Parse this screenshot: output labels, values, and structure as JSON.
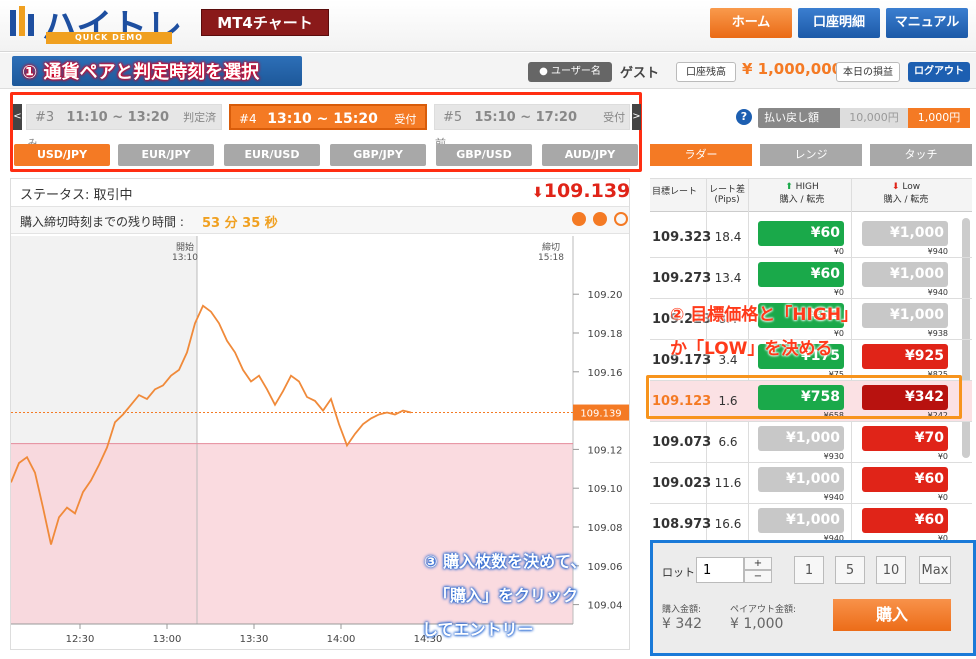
{
  "header": {
    "logo_text": "ハイトレ",
    "logo_sub": "QUICK DEMO",
    "mt4_button": "MT4チャート",
    "nav": [
      "ホーム",
      "口座明細",
      "マニュアル"
    ]
  },
  "account": {
    "user_badge": "ユーザー名",
    "user_name": "ゲスト",
    "balance_label": "口座残高",
    "balance_value": "¥ 1,000,000",
    "today_pl": "本日の損益",
    "logout": "ログアウト"
  },
  "annotations": {
    "step1": "① 通貨ペアと判定時刻を選択",
    "step2_line1": "② 目標価格と「HIGH」",
    "step2_line2": "か「LOW」を決める",
    "step3_line1": "③ 購入枚数を決めて、",
    "step3_line2": "「購入」をクリック",
    "step3_line3": "してエントリー"
  },
  "slots": [
    {
      "id": "#3",
      "time": "11:10 ~ 13:20",
      "status": "判定済み"
    },
    {
      "id": "#4",
      "time": "13:10 ~ 15:20",
      "status": "受付中"
    },
    {
      "id": "#5",
      "time": "15:10 ~ 17:20",
      "status": "受付前"
    }
  ],
  "slot_prev": "<",
  "slot_next": ">",
  "pairs": [
    "USD/JPY",
    "EUR/JPY",
    "EUR/USD",
    "GBP/JPY",
    "GBP/USD",
    "AUD/JPY"
  ],
  "payback": {
    "label": "払い戻し額",
    "opt1": "10,000円",
    "opt2": "1,000円"
  },
  "view_tabs": [
    "ラダー",
    "レンジ",
    "タッチ"
  ],
  "status": {
    "label": "ステータス: 取引中",
    "price": "109.139",
    "remaining_label": "購入締切時刻までの残り時間 :",
    "remaining_value": "53 分 35 秒"
  },
  "chart_labels": {
    "start": "開始",
    "start_time": "13:10",
    "close": "締切",
    "close_time": "15:18",
    "current": "109.139"
  },
  "chart_data": {
    "type": "line",
    "y_ticks": [
      "109.20",
      "109.18",
      "109.16",
      "109.14",
      "109.12",
      "109.10",
      "109.08",
      "109.06",
      "109.04"
    ],
    "x_ticks": [
      "12:30",
      "13:00",
      "13:30",
      "14:00",
      "14:30"
    ],
    "ylim": [
      109.03,
      109.23
    ],
    "target": 109.123,
    "current": 109.139,
    "series": [
      {
        "x": [
          0,
          8,
          16,
          24,
          32,
          40,
          48,
          56,
          64,
          72,
          80,
          88,
          96,
          104,
          112,
          120,
          128,
          136,
          144,
          152,
          160,
          168,
          176,
          184,
          192,
          200,
          208,
          216,
          224,
          232,
          240,
          248,
          256,
          264,
          272,
          280,
          288,
          296,
          304,
          312,
          320,
          328,
          336,
          344,
          352,
          360,
          368,
          376,
          384,
          392,
          400
        ],
        "y": [
          109.103,
          109.113,
          109.116,
          109.108,
          109.09,
          109.071,
          109.085,
          109.09,
          109.087,
          109.098,
          109.104,
          109.112,
          109.121,
          109.134,
          109.138,
          109.143,
          109.148,
          109.146,
          109.151,
          109.153,
          109.158,
          109.161,
          109.17,
          109.185,
          109.194,
          109.191,
          109.185,
          109.176,
          109.17,
          109.161,
          109.155,
          109.158,
          109.151,
          109.143,
          109.15,
          109.158,
          109.155,
          109.147,
          109.145,
          109.14,
          109.146,
          109.133,
          109.122,
          109.128,
          109.133,
          109.136,
          109.138,
          109.139,
          109.138,
          109.14,
          109.139
        ]
      }
    ]
  },
  "ladder": {
    "headers": {
      "rate": "目標レート",
      "diff": "レート差",
      "pips": "(Pips)",
      "high": "HIGH",
      "low": "Low",
      "buy": "購入 / 転売"
    },
    "rows": [
      {
        "rate": "109.323",
        "diff": "18.4",
        "high": "¥60",
        "high_sub": "¥0",
        "low": "¥1,000",
        "low_sub": "¥940"
      },
      {
        "rate": "109.273",
        "diff": "13.4",
        "high": "¥60",
        "high_sub": "¥0",
        "low": "¥1,000",
        "low_sub": "¥940"
      },
      {
        "rate": "109.223",
        "diff": "8.4",
        "high": "¥62",
        "high_sub": "¥0",
        "low": "¥1,000",
        "low_sub": "¥938"
      },
      {
        "rate": "109.173",
        "diff": "3.4",
        "high": "¥175",
        "high_sub": "¥75",
        "low": "¥925",
        "low_sub": "¥825"
      },
      {
        "rate": "109.123",
        "diff": "1.6",
        "high": "¥758",
        "high_sub": "¥658",
        "low": "¥342",
        "low_sub": "¥242"
      },
      {
        "rate": "109.073",
        "diff": "6.6",
        "high": "¥1,000",
        "high_sub": "¥930",
        "low": "¥70",
        "low_sub": "¥0"
      },
      {
        "rate": "109.023",
        "diff": "11.6",
        "high": "¥1,000",
        "high_sub": "¥940",
        "low": "¥60",
        "low_sub": "¥0"
      },
      {
        "rate": "108.973",
        "diff": "16.6",
        "high": "¥1,000",
        "high_sub": "¥940",
        "low": "¥60",
        "low_sub": "¥0"
      }
    ]
  },
  "order": {
    "lot_label": "ロット",
    "lot_value": "1",
    "plus": "+",
    "minus": "−",
    "quick": [
      "1",
      "5",
      "10",
      "Max"
    ],
    "purchase_label": "購入金額:",
    "purchase_value": "¥ 342",
    "payout_label": "ペイアウト金額:",
    "payout_value": "¥ 1,000",
    "buy_button": "購入"
  },
  "colors": {
    "orange": "#f47a24",
    "blue": "#1d5fb1",
    "green": "#1aa94a",
    "red": "#e02418",
    "darkred": "#b8120f"
  }
}
